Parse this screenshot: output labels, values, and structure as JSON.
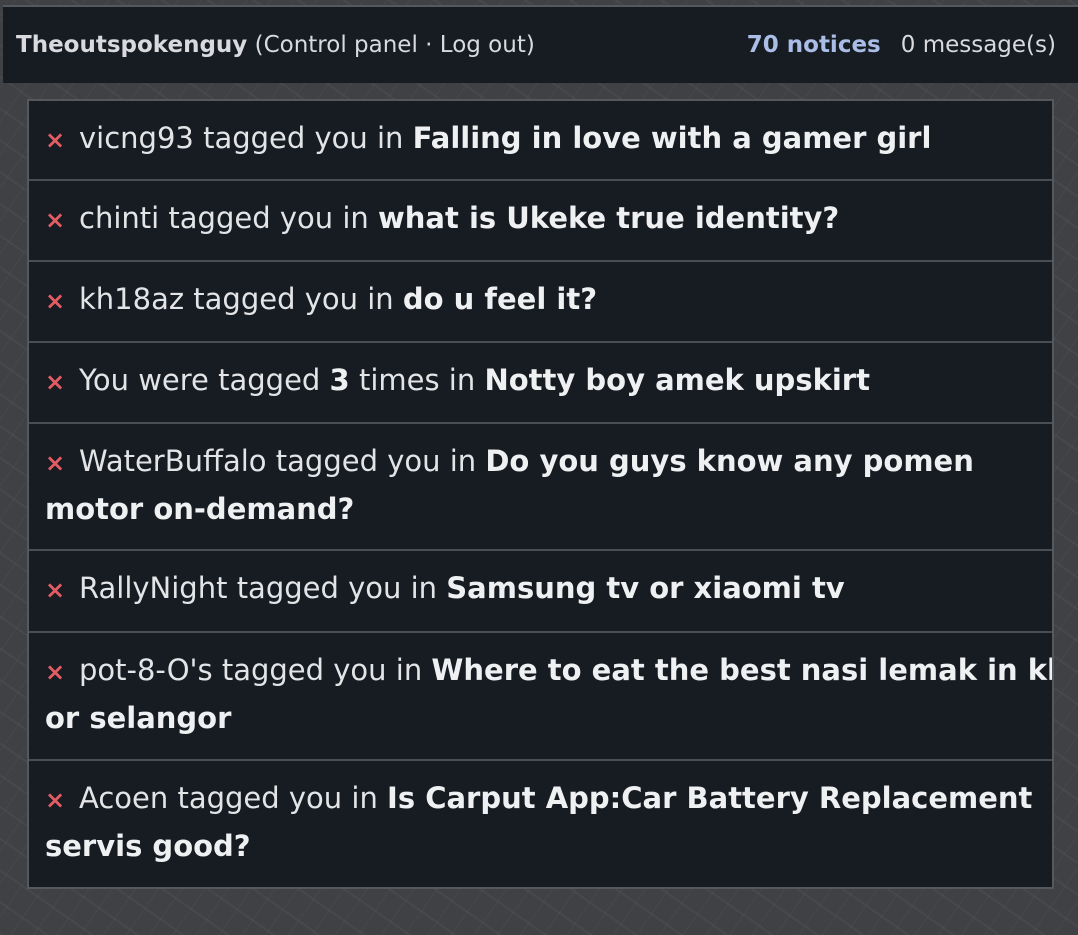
{
  "header": {
    "username": "Theoutspokenguy",
    "paren_open": " (",
    "control_panel": "Control panel",
    "separator": " · ",
    "log_out": "Log out",
    "paren_close": ")",
    "notices": "70 notices",
    "messages": "0 message(s)"
  },
  "notifications": [
    {
      "dismiss": "×",
      "prefix": "vicng93 tagged you in ",
      "title": "Falling in love with a gamer girl"
    },
    {
      "dismiss": "×",
      "prefix": "chinti tagged you in ",
      "title": "what is Ukeke true identity?"
    },
    {
      "dismiss": "×",
      "prefix": "kh18az tagged you in ",
      "title": "do u feel it?"
    },
    {
      "dismiss": "×",
      "prefix_a": "You were tagged ",
      "count": "3",
      "prefix_b": " times in ",
      "title": "Notty boy amek upskirt"
    },
    {
      "dismiss": "×",
      "prefix": "WaterBuffalo tagged you in ",
      "title": "Do you guys know any pomen motor on-demand?"
    },
    {
      "dismiss": "×",
      "prefix": "RallyNight tagged you in ",
      "title": "Samsung tv or xiaomi tv"
    },
    {
      "dismiss": "×",
      "prefix": "pot-8-O's tagged you in ",
      "title": "Where to eat the best nasi lemak in kl or selangor"
    },
    {
      "dismiss": "×",
      "prefix": "Acoen tagged you in ",
      "title": "Is Carput App:Car Battery Replacement servis good?"
    }
  ],
  "colors": {
    "topbar_bg": "#171b22",
    "item_bg": "#171b22",
    "notices_link": "#a9bde6",
    "dismiss_x": "#e25c64"
  }
}
